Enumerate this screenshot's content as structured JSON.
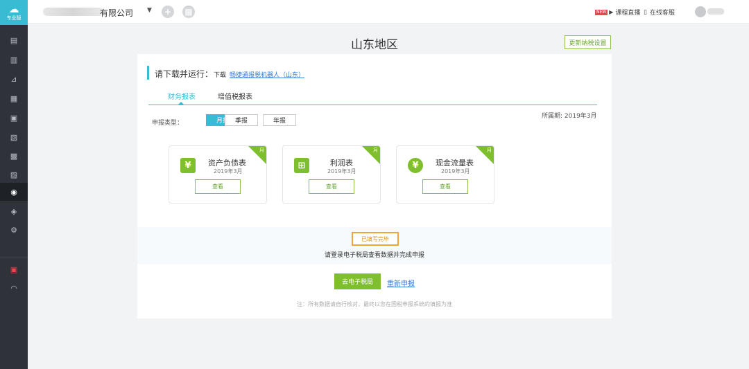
{
  "app": {
    "logo_label": "专业版"
  },
  "topbar": {
    "company_name": "有限公司",
    "live_label": "课程直播",
    "service_label": "在线客服"
  },
  "main": {
    "region_title": "山东地区",
    "update_settings_label": "更新纳税设置",
    "tip_text": "请下载并运行：",
    "tip_download_prefix": "下载",
    "tip_link": "畅捷通报税机器人（山东）",
    "tabs": [
      {
        "label": "财务报表",
        "active": true
      },
      {
        "label": "增值税报表",
        "active": false
      }
    ],
    "period": "所属期: 2019年3月",
    "type_label": "申报类型：",
    "types": [
      {
        "label": "月报",
        "active": true
      },
      {
        "label": "季报",
        "active": false
      },
      {
        "label": "年报",
        "active": false
      }
    ],
    "cards": [
      {
        "title": "资产负债表",
        "date": "2019年3月",
        "badge": "月",
        "button": "查看",
        "icon": "yen-box-icon"
      },
      {
        "title": "利润表",
        "date": "2019年3月",
        "badge": "月",
        "button": "查看",
        "icon": "profit-cart-icon"
      },
      {
        "title": "现金流量表",
        "date": "2019年3月",
        "badge": "月",
        "button": "查看",
        "icon": "coin-stack-icon"
      }
    ],
    "done_badge": "已填写完毕",
    "done_text": "请登录电子税局查看数据并完成申报",
    "go_button": "去电子税局",
    "redo_link": "重新申报",
    "note": "注：所有数据请自行核对，最终以您在国税申报系统的填报为准"
  },
  "colors": {
    "accent": "#37bcd3",
    "green": "#7fbf2e",
    "orange": "#f0a43c",
    "link": "#3a7bd5"
  }
}
